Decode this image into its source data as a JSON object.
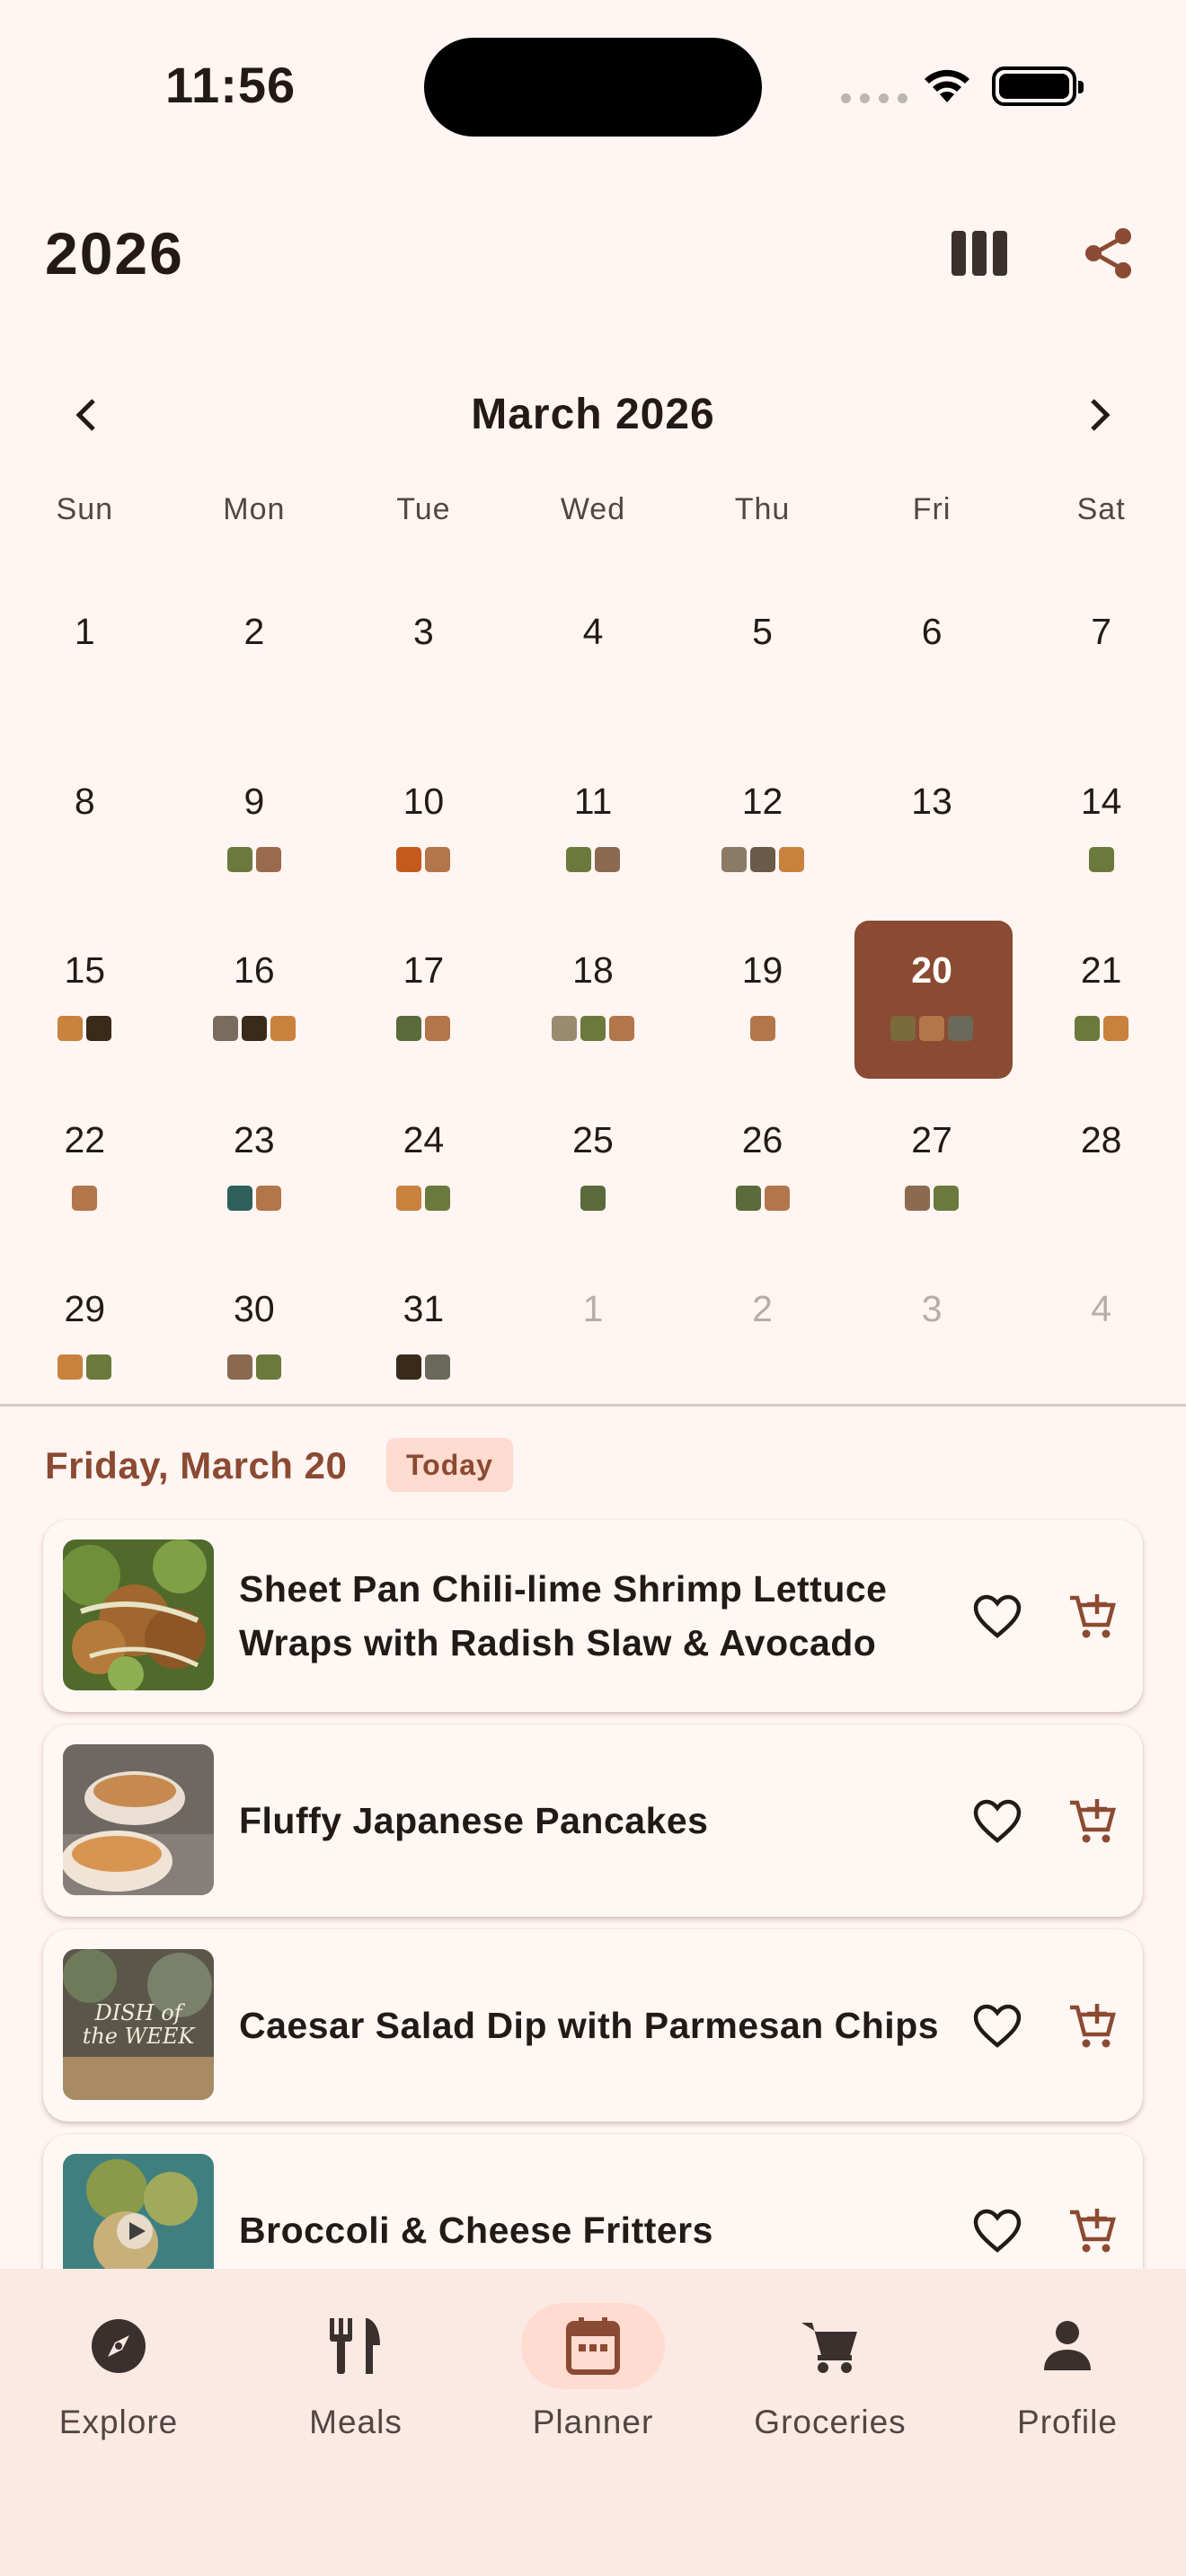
{
  "status_bar": {
    "time": "11:56"
  },
  "header": {
    "title": "2026",
    "view_icon": "columns-icon",
    "share_icon": "share-icon"
  },
  "calendar": {
    "month_title": "March 2026",
    "weekdays": [
      "Sun",
      "Mon",
      "Tue",
      "Wed",
      "Thu",
      "Fri",
      "Sat"
    ],
    "days": [
      {
        "n": "1",
        "thumbs": []
      },
      {
        "n": "2",
        "thumbs": []
      },
      {
        "n": "3",
        "thumbs": []
      },
      {
        "n": "4",
        "thumbs": []
      },
      {
        "n": "5",
        "thumbs": []
      },
      {
        "n": "6",
        "thumbs": []
      },
      {
        "n": "7",
        "thumbs": []
      },
      {
        "n": "8",
        "thumbs": []
      },
      {
        "n": "9",
        "thumbs": [
          "#6b7a3c",
          "#9a6a4c"
        ]
      },
      {
        "n": "10",
        "thumbs": [
          "#c55a1e",
          "#b2764a"
        ]
      },
      {
        "n": "11",
        "thumbs": [
          "#6b7a3c",
          "#8a6a50"
        ]
      },
      {
        "n": "12",
        "thumbs": [
          "#8b7a64",
          "#6a5a48",
          "#c9813e"
        ]
      },
      {
        "n": "13",
        "thumbs": []
      },
      {
        "n": "14",
        "thumbs": [
          "#6b7a3c"
        ]
      },
      {
        "n": "15",
        "thumbs": [
          "#c9813e",
          "#3a2a1a"
        ]
      },
      {
        "n": "16",
        "thumbs": [
          "#7a6c5c",
          "#3a2a1a",
          "#c9813e"
        ]
      },
      {
        "n": "17",
        "thumbs": [
          "#5a6a3a",
          "#b2764a"
        ]
      },
      {
        "n": "18",
        "thumbs": [
          "#9a8a70",
          "#6b7a3c",
          "#b2764a"
        ]
      },
      {
        "n": "19",
        "thumbs": [
          "#b2764a"
        ]
      },
      {
        "n": "20",
        "thumbs": [
          "#7a6a3c",
          "#b2764a",
          "#6b6a5a"
        ],
        "today": true
      },
      {
        "n": "21",
        "thumbs": [
          "#6b7a3c",
          "#c9813e"
        ]
      },
      {
        "n": "22",
        "thumbs": [
          "#b2764a"
        ]
      },
      {
        "n": "23",
        "thumbs": [
          "#2f5f5a",
          "#b2764a"
        ]
      },
      {
        "n": "24",
        "thumbs": [
          "#c9813e",
          "#6b7a3c"
        ]
      },
      {
        "n": "25",
        "thumbs": [
          "#5a6a3a"
        ]
      },
      {
        "n": "26",
        "thumbs": [
          "#5a6a3a",
          "#b2764a"
        ]
      },
      {
        "n": "27",
        "thumbs": [
          "#8a6a50",
          "#6b7a3c"
        ]
      },
      {
        "n": "28",
        "thumbs": []
      },
      {
        "n": "29",
        "thumbs": [
          "#c9813e",
          "#6b7a3c"
        ]
      },
      {
        "n": "30",
        "thumbs": [
          "#8a6a50",
          "#6b7a3c"
        ]
      },
      {
        "n": "31",
        "thumbs": [
          "#3a2a1a",
          "#6b6a5a"
        ]
      },
      {
        "n": "1",
        "thumbs": [],
        "other": true
      },
      {
        "n": "2",
        "thumbs": [],
        "other": true
      },
      {
        "n": "3",
        "thumbs": [],
        "other": true
      },
      {
        "n": "4",
        "thumbs": [],
        "other": true
      }
    ]
  },
  "selected_day": {
    "label": "Friday, March 20",
    "badge": "Today"
  },
  "meals": [
    {
      "title": "Sheet Pan Chili-lime Shrimp Lettuce Wraps with Radish Slaw & Avocado",
      "image": "shrimp-lettuce-wraps"
    },
    {
      "title": "Fluffy Japanese Pancakes",
      "image": "japanese-pancakes"
    },
    {
      "title": "Caesar Salad Dip with Parmesan Chips",
      "image": "caesar-dip",
      "image_text": [
        "DISH of",
        "the WEEK"
      ]
    },
    {
      "title": "Broccoli & Cheese Fritters",
      "image": "broccoli-fritters"
    }
  ],
  "nav": {
    "items": [
      {
        "label": "Explore",
        "icon": "compass-icon"
      },
      {
        "label": "Meals",
        "icon": "utensils-icon"
      },
      {
        "label": "Planner",
        "icon": "calendar-icon",
        "active": true
      },
      {
        "label": "Groceries",
        "icon": "cart-icon"
      },
      {
        "label": "Profile",
        "icon": "person-icon"
      }
    ]
  },
  "colors": {
    "accent": "#8b4a32",
    "background": "#fff5f2",
    "badge_bg": "#ffdbd0",
    "nav_bg": "#fbe9e3"
  }
}
